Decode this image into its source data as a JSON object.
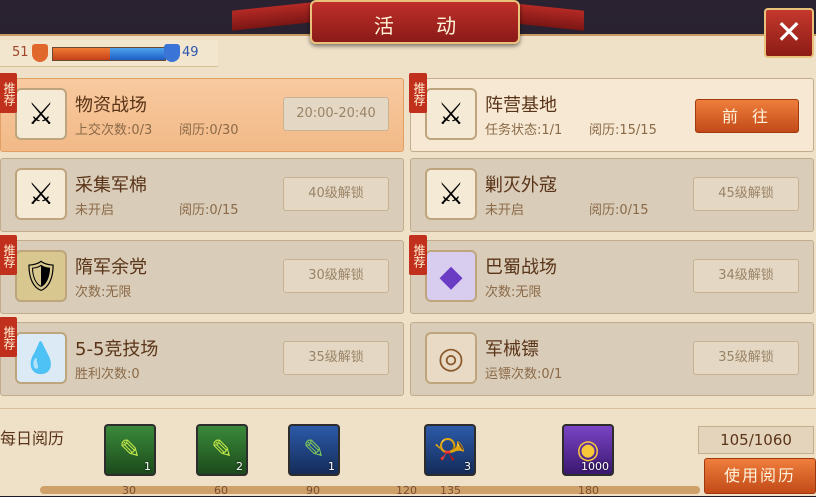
{
  "header": {
    "title": "活 动",
    "close_label": "✕"
  },
  "level_bar": {
    "left_value": "51",
    "right_value": "49",
    "left_fraction": 0.51
  },
  "activities": [
    {
      "name": "物资战场",
      "sub1": "上交次数:0/3",
      "sub2": "阅历:0/30",
      "status": "20:00-20:40",
      "tag": "推荐",
      "icon": "crossed-swords"
    },
    {
      "name": "阵营基地",
      "sub1": "任务状态:1/1",
      "sub2": "阅历:15/15",
      "action": "前往",
      "tag": "推荐",
      "icon": "crossed-swords"
    },
    {
      "name": "采集军棉",
      "sub1": "未开启",
      "sub2": "阅历:0/15",
      "status": "40级解锁",
      "icon": "crossed-swords"
    },
    {
      "name": "剿灭外寇",
      "sub1": "未开启",
      "sub2": "阅历:0/15",
      "status": "45级解锁",
      "icon": "crossed-swords"
    },
    {
      "name": "隋军余党",
      "sub1": "次数:无限",
      "status": "30级解锁",
      "tag": "推荐",
      "icon": "armor"
    },
    {
      "name": "巴蜀战场",
      "sub1": "次数:无限",
      "status": "34级解锁",
      "tag": "推荐",
      "icon": "purple-gem"
    },
    {
      "name": "5-5竞技场",
      "sub1": "胜利次数:0",
      "status": "35级解锁",
      "tag": "推荐",
      "icon": "blue-crystal"
    },
    {
      "name": "军械镖",
      "sub1": "运镖次数:0/1",
      "status": "35级解锁",
      "icon": "coins"
    }
  ],
  "daily": {
    "label": "每日阅历",
    "rewards": [
      {
        "icon": "green-scroll",
        "count": "1"
      },
      {
        "icon": "green-scroll",
        "count": "2"
      },
      {
        "icon": "blue-scroll",
        "count": "1"
      },
      {
        "icon": "horn",
        "count": "3"
      },
      {
        "icon": "gold-coins",
        "count": "1000"
      }
    ],
    "ticks": [
      "30",
      "60",
      "90",
      "120",
      "135",
      "180"
    ],
    "counter": "105/1060",
    "use_label": "使用阅历"
  }
}
